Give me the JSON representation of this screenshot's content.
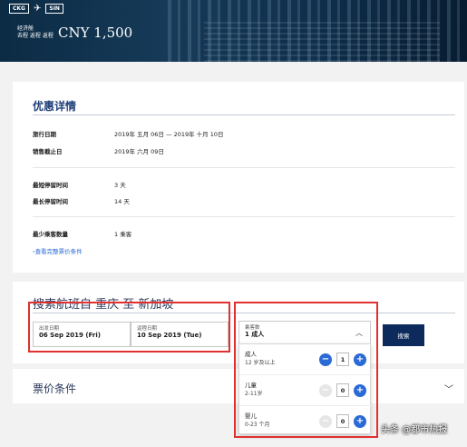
{
  "hero": {
    "origin_code": "CKG",
    "destination_code": "SIN",
    "cabin_line1": "经济舱",
    "cabin_line2": "去程 返程 返程",
    "price": "CNY 1,500"
  },
  "details": {
    "title": "优惠详情",
    "rows": [
      {
        "label": "旅行日期",
        "value": "2019年 五月 06日 — 2019年 十月 10日"
      },
      {
        "label": "销售截止日",
        "value": "2019年 六月 09日"
      },
      {
        "label": "最短停留时间",
        "value": "3 天"
      },
      {
        "label": "最长停留时间",
        "value": "14 天"
      },
      {
        "label": "最少乘客数量",
        "value": "1 乘客"
      }
    ],
    "link": "›查看完整票价条件"
  },
  "search": {
    "title": "搜索航班自 重庆 至 新加坡",
    "depart_label": "出发日期",
    "depart_value": "06 Sep 2019 (Fri)",
    "return_label": "返程日期",
    "return_value": "10 Sep 2019 (Tue)",
    "pax_label": "乘客数",
    "pax_value": "1 成人",
    "search_button": "搜索"
  },
  "passengers": [
    {
      "label": "成人",
      "sub": "12 岁及以上",
      "count": "1"
    },
    {
      "label": "儿童",
      "sub": "2-11岁",
      "count": "0"
    },
    {
      "label": "婴儿",
      "sub": "0-23 个月",
      "count": "0"
    }
  ],
  "fare": {
    "title": "票价条件"
  },
  "watermark": "头条 @都市热报",
  "colors": {
    "accent": "#2a6ad6",
    "title_blue": "#1f3f7a",
    "button_navy": "#0c2b5c",
    "annotation_red": "#e03030"
  },
  "icons": {
    "plane": "plane-icon",
    "chevron_up": "chevron-up-icon",
    "chevron_down": "chevron-down-icon",
    "minus": "minus-icon",
    "plus": "plus-icon"
  }
}
